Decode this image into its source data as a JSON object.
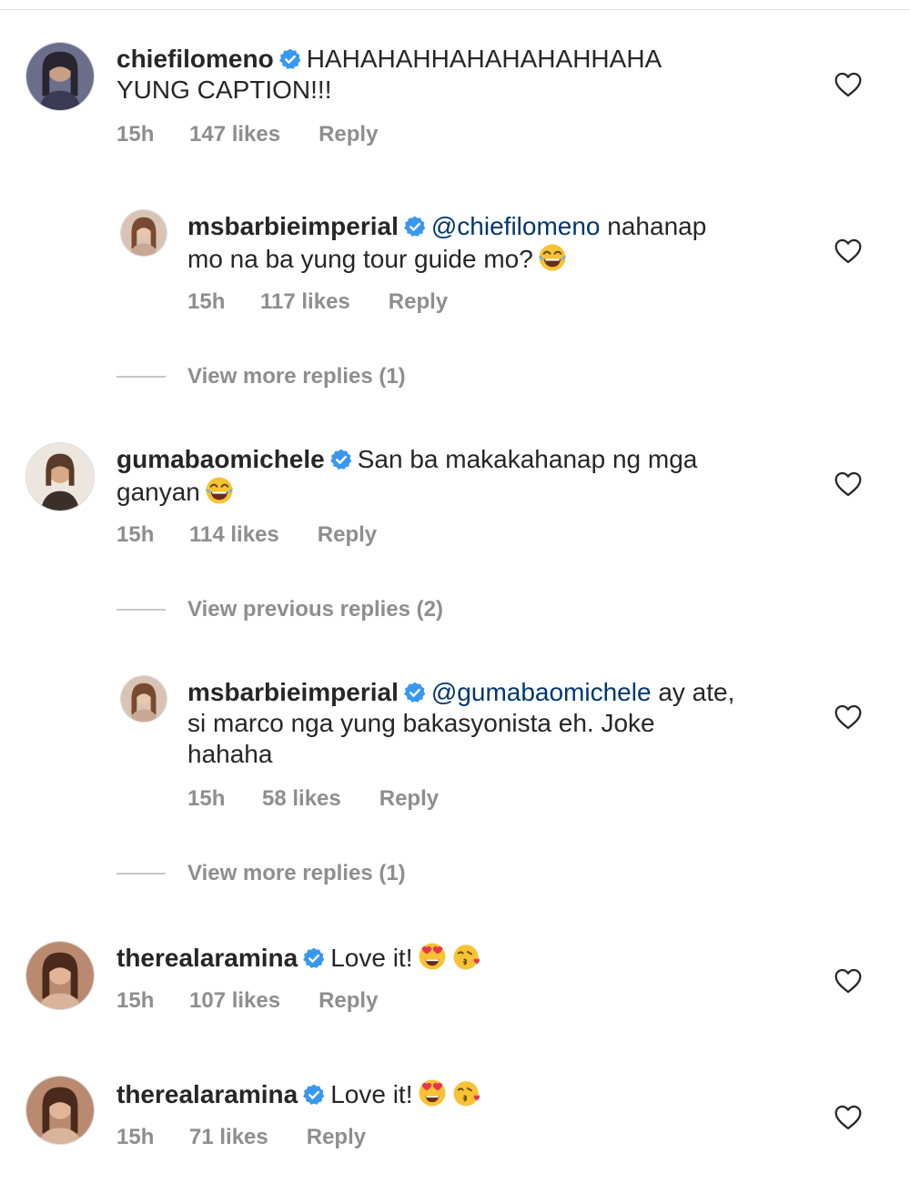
{
  "comments": [
    {
      "username": "chiefilomeno",
      "line1": "HAHAHAHHAHAHAHAHHAHA",
      "line2": "YUNG CAPTION!!!",
      "time": "15h",
      "likes": "147 likes",
      "reply": "Reply"
    },
    {
      "username": "msbarbieimperial",
      "mention": "@chiefilomeno",
      "line1": " nahanap",
      "line2": "mo na ba yung tour guide mo?",
      "emoji": "tears-of-joy-emoji",
      "time": "15h",
      "likes": "117 likes",
      "reply": "Reply"
    },
    {
      "username": "gumabaomichele",
      "line1": "San ba makakahanap ng mga",
      "line2": "ganyan",
      "emoji": "tears-of-joy-emoji",
      "time": "15h",
      "likes": "114 likes",
      "reply": "Reply"
    },
    {
      "username": "msbarbieimperial",
      "mention": "@gumabaomichele",
      "line1": " ay ate,",
      "line2": "si marco nga yung bakasyonista eh. Joke",
      "line3": "hahaha",
      "time": "15h",
      "likes": "58 likes",
      "reply": "Reply"
    },
    {
      "username": "therealaramina",
      "line1": "Love it!",
      "emoji": "heart-eyes-emoji",
      "emoji2": "kissing-heart-emoji",
      "time": "15h",
      "likes": "107 likes",
      "reply": "Reply"
    },
    {
      "username": "therealaramina",
      "line1": "Love it!",
      "emoji": "heart-eyes-emoji",
      "emoji2": "kissing-heart-emoji",
      "time": "15h",
      "likes": "71 likes",
      "reply": "Reply"
    }
  ],
  "view_more": [
    "View more replies (1)",
    "View previous replies (2)",
    "View more replies (1)"
  ],
  "icons": {
    "verified": "verified-badge-icon",
    "like": "heart-outline-icon"
  },
  "colors": {
    "verified": "#3897f0",
    "mention": "#00376b",
    "meta": "#8e8e8e"
  }
}
